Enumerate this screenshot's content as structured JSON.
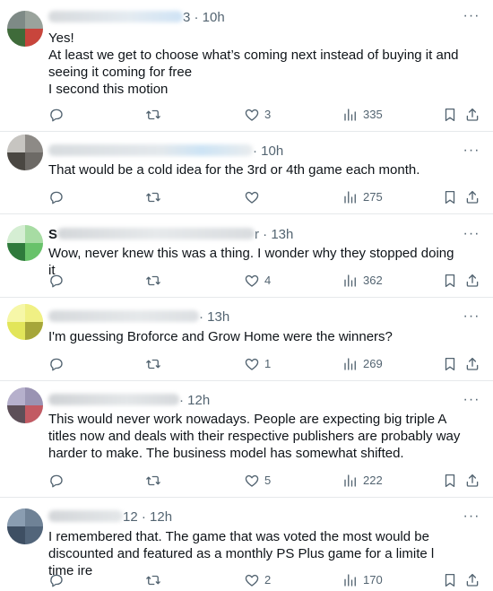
{
  "replies": [
    {
      "header_suffix": "3 · 10h",
      "lines": [
        "Yes!",
        "At least we get to choose what’s coming next instead of buying it and seeing it coming for free",
        "I second this motion"
      ],
      "counts": {
        "replies": "",
        "reposts": "",
        "likes": "3",
        "views": "335"
      }
    },
    {
      "header_suffix": "· 10h",
      "lines": [
        "That would be a cold idea for the 3rd or 4th game each month."
      ],
      "counts": {
        "replies": "",
        "reposts": "",
        "likes": "",
        "views": "275"
      }
    },
    {
      "header_prefix": "S",
      "header_suffix": "r · 13h",
      "lines": [
        "Wow, never knew this was a thing. I wonder why they stopped doing it"
      ],
      "counts": {
        "replies": "",
        "reposts": "",
        "likes": "4",
        "views": "362"
      }
    },
    {
      "header_suffix": "· 13h",
      "lines": [
        "I'm guessing Broforce and Grow Home were the winners?"
      ],
      "counts": {
        "replies": "",
        "reposts": "",
        "likes": "1",
        "views": "269"
      }
    },
    {
      "header_suffix": "· 12h",
      "lines": [
        "This would never work nowadays. People are expecting big triple A titles now and deals with their respective publishers are probably way harder to make. The business model has somewhat shifted."
      ],
      "counts": {
        "replies": "",
        "reposts": "",
        "likes": "5",
        "views": "222"
      }
    },
    {
      "header_suffix": "12 · 12h",
      "lines": [
        "I remembered that. The game that was voted the most would be discounted and featured as a monthly PS Plus game for a limite  l time ire"
      ],
      "counts": {
        "replies": "",
        "reposts": "",
        "likes": "2",
        "views": "170"
      }
    }
  ],
  "icons": {
    "reply": "reply-icon",
    "repost": "repost-icon",
    "like": "heart-icon",
    "views": "views-icon",
    "bookmark": "bookmark-icon",
    "share": "share-icon",
    "more": "more-icon"
  },
  "colors": {
    "text": "#0f1419",
    "secondary": "#536471",
    "divider": "#e6e9eb"
  }
}
